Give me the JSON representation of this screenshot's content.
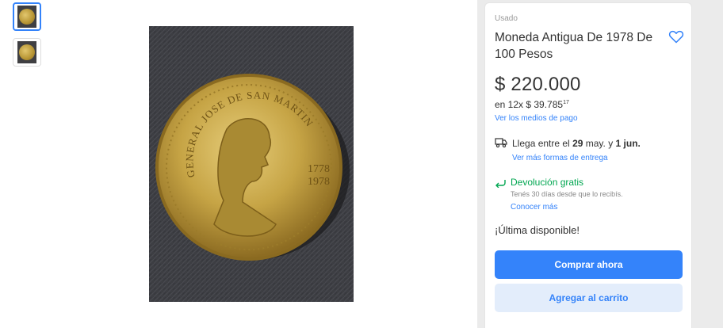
{
  "gallery": {
    "thumbnails": [
      {
        "label": "coin-photo-1",
        "active": true
      },
      {
        "label": "coin-photo-2",
        "active": false
      }
    ],
    "coin": {
      "legend": "GENERAL JOSE DE SAN MARTIN",
      "year_top": "1778",
      "year_bottom": "1978"
    }
  },
  "product": {
    "condition": "Usado",
    "title": "Moneda Antigua De 1978 De 100 Pesos",
    "favorite_icon": "heart-outline-icon",
    "price": "$ 220.000",
    "installments_prefix": "en 12x $ 39.785",
    "installments_cents": "17",
    "payment_link": "Ver los medios de pago"
  },
  "shipping": {
    "icon": "truck-icon",
    "text_prefix": "Llega entre el ",
    "date_start": "29",
    "text_middle": " may. y ",
    "date_end": "1 jun.",
    "link": "Ver más formas de entrega"
  },
  "returns": {
    "icon": "return-arrow-icon",
    "title": "Devolución gratis",
    "subtitle": "Tenés 30 días desde que lo recibís.",
    "link": "Conocer más"
  },
  "stock": "¡Última disponible!",
  "actions": {
    "buy_now": "Comprar ahora",
    "add_to_cart": "Agregar al carrito"
  },
  "colors": {
    "accent": "#3483fa",
    "accent_light": "#e3edfb",
    "success": "#00a650",
    "text": "#333333",
    "muted": "#999999"
  }
}
